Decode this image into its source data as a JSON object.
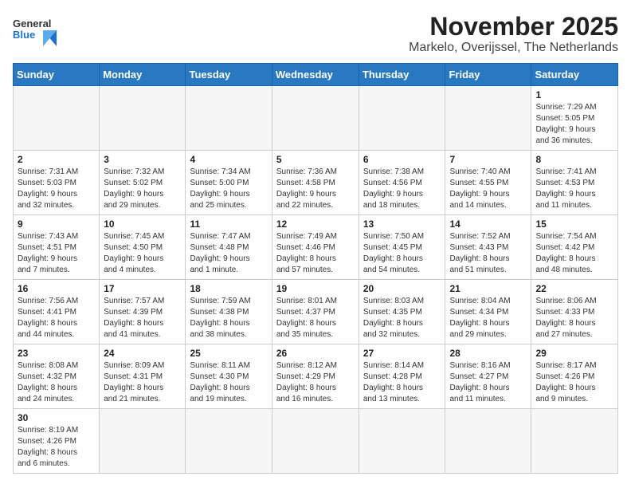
{
  "header": {
    "logo_general": "General",
    "logo_blue": "Blue",
    "title": "November 2025",
    "subtitle": "Markelo, Overijssel, The Netherlands"
  },
  "weekdays": [
    "Sunday",
    "Monday",
    "Tuesday",
    "Wednesday",
    "Thursday",
    "Friday",
    "Saturday"
  ],
  "weeks": [
    [
      {
        "day": "",
        "info": ""
      },
      {
        "day": "",
        "info": ""
      },
      {
        "day": "",
        "info": ""
      },
      {
        "day": "",
        "info": ""
      },
      {
        "day": "",
        "info": ""
      },
      {
        "day": "",
        "info": ""
      },
      {
        "day": "1",
        "info": "Sunrise: 7:29 AM\nSunset: 5:05 PM\nDaylight: 9 hours\nand 36 minutes."
      }
    ],
    [
      {
        "day": "2",
        "info": "Sunrise: 7:31 AM\nSunset: 5:03 PM\nDaylight: 9 hours\nand 32 minutes."
      },
      {
        "day": "3",
        "info": "Sunrise: 7:32 AM\nSunset: 5:02 PM\nDaylight: 9 hours\nand 29 minutes."
      },
      {
        "day": "4",
        "info": "Sunrise: 7:34 AM\nSunset: 5:00 PM\nDaylight: 9 hours\nand 25 minutes."
      },
      {
        "day": "5",
        "info": "Sunrise: 7:36 AM\nSunset: 4:58 PM\nDaylight: 9 hours\nand 22 minutes."
      },
      {
        "day": "6",
        "info": "Sunrise: 7:38 AM\nSunset: 4:56 PM\nDaylight: 9 hours\nand 18 minutes."
      },
      {
        "day": "7",
        "info": "Sunrise: 7:40 AM\nSunset: 4:55 PM\nDaylight: 9 hours\nand 14 minutes."
      },
      {
        "day": "8",
        "info": "Sunrise: 7:41 AM\nSunset: 4:53 PM\nDaylight: 9 hours\nand 11 minutes."
      }
    ],
    [
      {
        "day": "9",
        "info": "Sunrise: 7:43 AM\nSunset: 4:51 PM\nDaylight: 9 hours\nand 7 minutes."
      },
      {
        "day": "10",
        "info": "Sunrise: 7:45 AM\nSunset: 4:50 PM\nDaylight: 9 hours\nand 4 minutes."
      },
      {
        "day": "11",
        "info": "Sunrise: 7:47 AM\nSunset: 4:48 PM\nDaylight: 9 hours\nand 1 minute."
      },
      {
        "day": "12",
        "info": "Sunrise: 7:49 AM\nSunset: 4:46 PM\nDaylight: 8 hours\nand 57 minutes."
      },
      {
        "day": "13",
        "info": "Sunrise: 7:50 AM\nSunset: 4:45 PM\nDaylight: 8 hours\nand 54 minutes."
      },
      {
        "day": "14",
        "info": "Sunrise: 7:52 AM\nSunset: 4:43 PM\nDaylight: 8 hours\nand 51 minutes."
      },
      {
        "day": "15",
        "info": "Sunrise: 7:54 AM\nSunset: 4:42 PM\nDaylight: 8 hours\nand 48 minutes."
      }
    ],
    [
      {
        "day": "16",
        "info": "Sunrise: 7:56 AM\nSunset: 4:41 PM\nDaylight: 8 hours\nand 44 minutes."
      },
      {
        "day": "17",
        "info": "Sunrise: 7:57 AM\nSunset: 4:39 PM\nDaylight: 8 hours\nand 41 minutes."
      },
      {
        "day": "18",
        "info": "Sunrise: 7:59 AM\nSunset: 4:38 PM\nDaylight: 8 hours\nand 38 minutes."
      },
      {
        "day": "19",
        "info": "Sunrise: 8:01 AM\nSunset: 4:37 PM\nDaylight: 8 hours\nand 35 minutes."
      },
      {
        "day": "20",
        "info": "Sunrise: 8:03 AM\nSunset: 4:35 PM\nDaylight: 8 hours\nand 32 minutes."
      },
      {
        "day": "21",
        "info": "Sunrise: 8:04 AM\nSunset: 4:34 PM\nDaylight: 8 hours\nand 29 minutes."
      },
      {
        "day": "22",
        "info": "Sunrise: 8:06 AM\nSunset: 4:33 PM\nDaylight: 8 hours\nand 27 minutes."
      }
    ],
    [
      {
        "day": "23",
        "info": "Sunrise: 8:08 AM\nSunset: 4:32 PM\nDaylight: 8 hours\nand 24 minutes."
      },
      {
        "day": "24",
        "info": "Sunrise: 8:09 AM\nSunset: 4:31 PM\nDaylight: 8 hours\nand 21 minutes."
      },
      {
        "day": "25",
        "info": "Sunrise: 8:11 AM\nSunset: 4:30 PM\nDaylight: 8 hours\nand 19 minutes."
      },
      {
        "day": "26",
        "info": "Sunrise: 8:12 AM\nSunset: 4:29 PM\nDaylight: 8 hours\nand 16 minutes."
      },
      {
        "day": "27",
        "info": "Sunrise: 8:14 AM\nSunset: 4:28 PM\nDaylight: 8 hours\nand 13 minutes."
      },
      {
        "day": "28",
        "info": "Sunrise: 8:16 AM\nSunset: 4:27 PM\nDaylight: 8 hours\nand 11 minutes."
      },
      {
        "day": "29",
        "info": "Sunrise: 8:17 AM\nSunset: 4:26 PM\nDaylight: 8 hours\nand 9 minutes."
      }
    ],
    [
      {
        "day": "30",
        "info": "Sunrise: 8:19 AM\nSunset: 4:26 PM\nDaylight: 8 hours\nand 6 minutes."
      },
      {
        "day": "",
        "info": ""
      },
      {
        "day": "",
        "info": ""
      },
      {
        "day": "",
        "info": ""
      },
      {
        "day": "",
        "info": ""
      },
      {
        "day": "",
        "info": ""
      },
      {
        "day": "",
        "info": ""
      }
    ]
  ]
}
